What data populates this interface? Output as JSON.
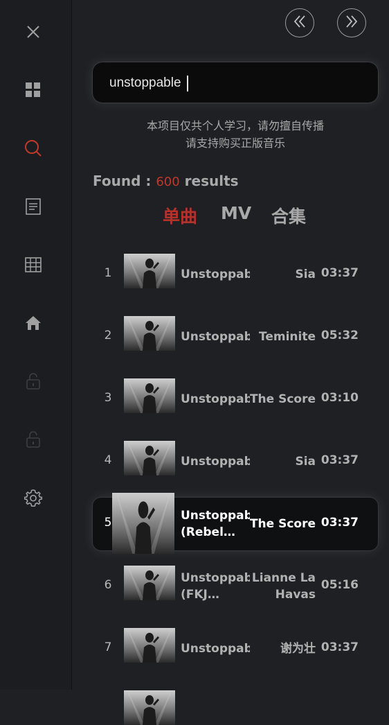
{
  "sidebar": {
    "items": [
      {
        "icon": "close-icon",
        "active": false
      },
      {
        "icon": "grid-icon",
        "active": false
      },
      {
        "icon": "search-icon",
        "active": true
      },
      {
        "icon": "document-icon",
        "active": false
      },
      {
        "icon": "table-icon",
        "active": false
      },
      {
        "icon": "home-icon",
        "active": false
      },
      {
        "icon": "lock-icon",
        "active": false
      },
      {
        "icon": "lock-icon",
        "active": false
      },
      {
        "icon": "gear-icon",
        "active": false
      }
    ]
  },
  "nav": {
    "back_icon": "double-chevron-left-icon",
    "forward_icon": "double-chevron-right-icon"
  },
  "search": {
    "value": "unstoppable"
  },
  "notice": {
    "line1": "本项目仅共个人学习，请勿擅自传播",
    "line2": "请支持购买正版音乐"
  },
  "found": {
    "label": "Found :",
    "count": "600",
    "suffix": "results"
  },
  "tabs": [
    {
      "label": "单曲",
      "active": true
    },
    {
      "label": "MV",
      "active": false
    },
    {
      "label": "合集",
      "active": false
    }
  ],
  "results": [
    {
      "index": "1",
      "title": "Unstoppabl",
      "title2": "",
      "artist": "Sia",
      "artist2": "",
      "duration": "03:37"
    },
    {
      "index": "2",
      "title": "Unstoppabl",
      "title2": "",
      "artist": "Teminite",
      "artist2": "",
      "duration": "05:32"
    },
    {
      "index": "3",
      "title": "Unstoppabl",
      "title2": "",
      "artist": "The Score",
      "artist2": "",
      "duration": "03:10"
    },
    {
      "index": "4",
      "title": "Unstoppabl",
      "title2": "",
      "artist": "Sia",
      "artist2": "",
      "duration": "03:37"
    },
    {
      "index": "5",
      "title": "Unstoppabl",
      "title2": "(Rebel…",
      "artist": "The Score",
      "artist2": "",
      "duration": "03:37"
    },
    {
      "index": "6",
      "title": "Unstoppabl",
      "title2": "(FKJ…",
      "artist": "Lianne La",
      "artist2": "Havas",
      "duration": "05:16"
    },
    {
      "index": "7",
      "title": "Unstoppabl",
      "title2": "",
      "artist": "谢为壮",
      "artist2": "",
      "duration": "03:37"
    }
  ],
  "colors": {
    "accent": "#b3322a",
    "background": "#1e2023",
    "sidebar": "#1b1d20"
  }
}
